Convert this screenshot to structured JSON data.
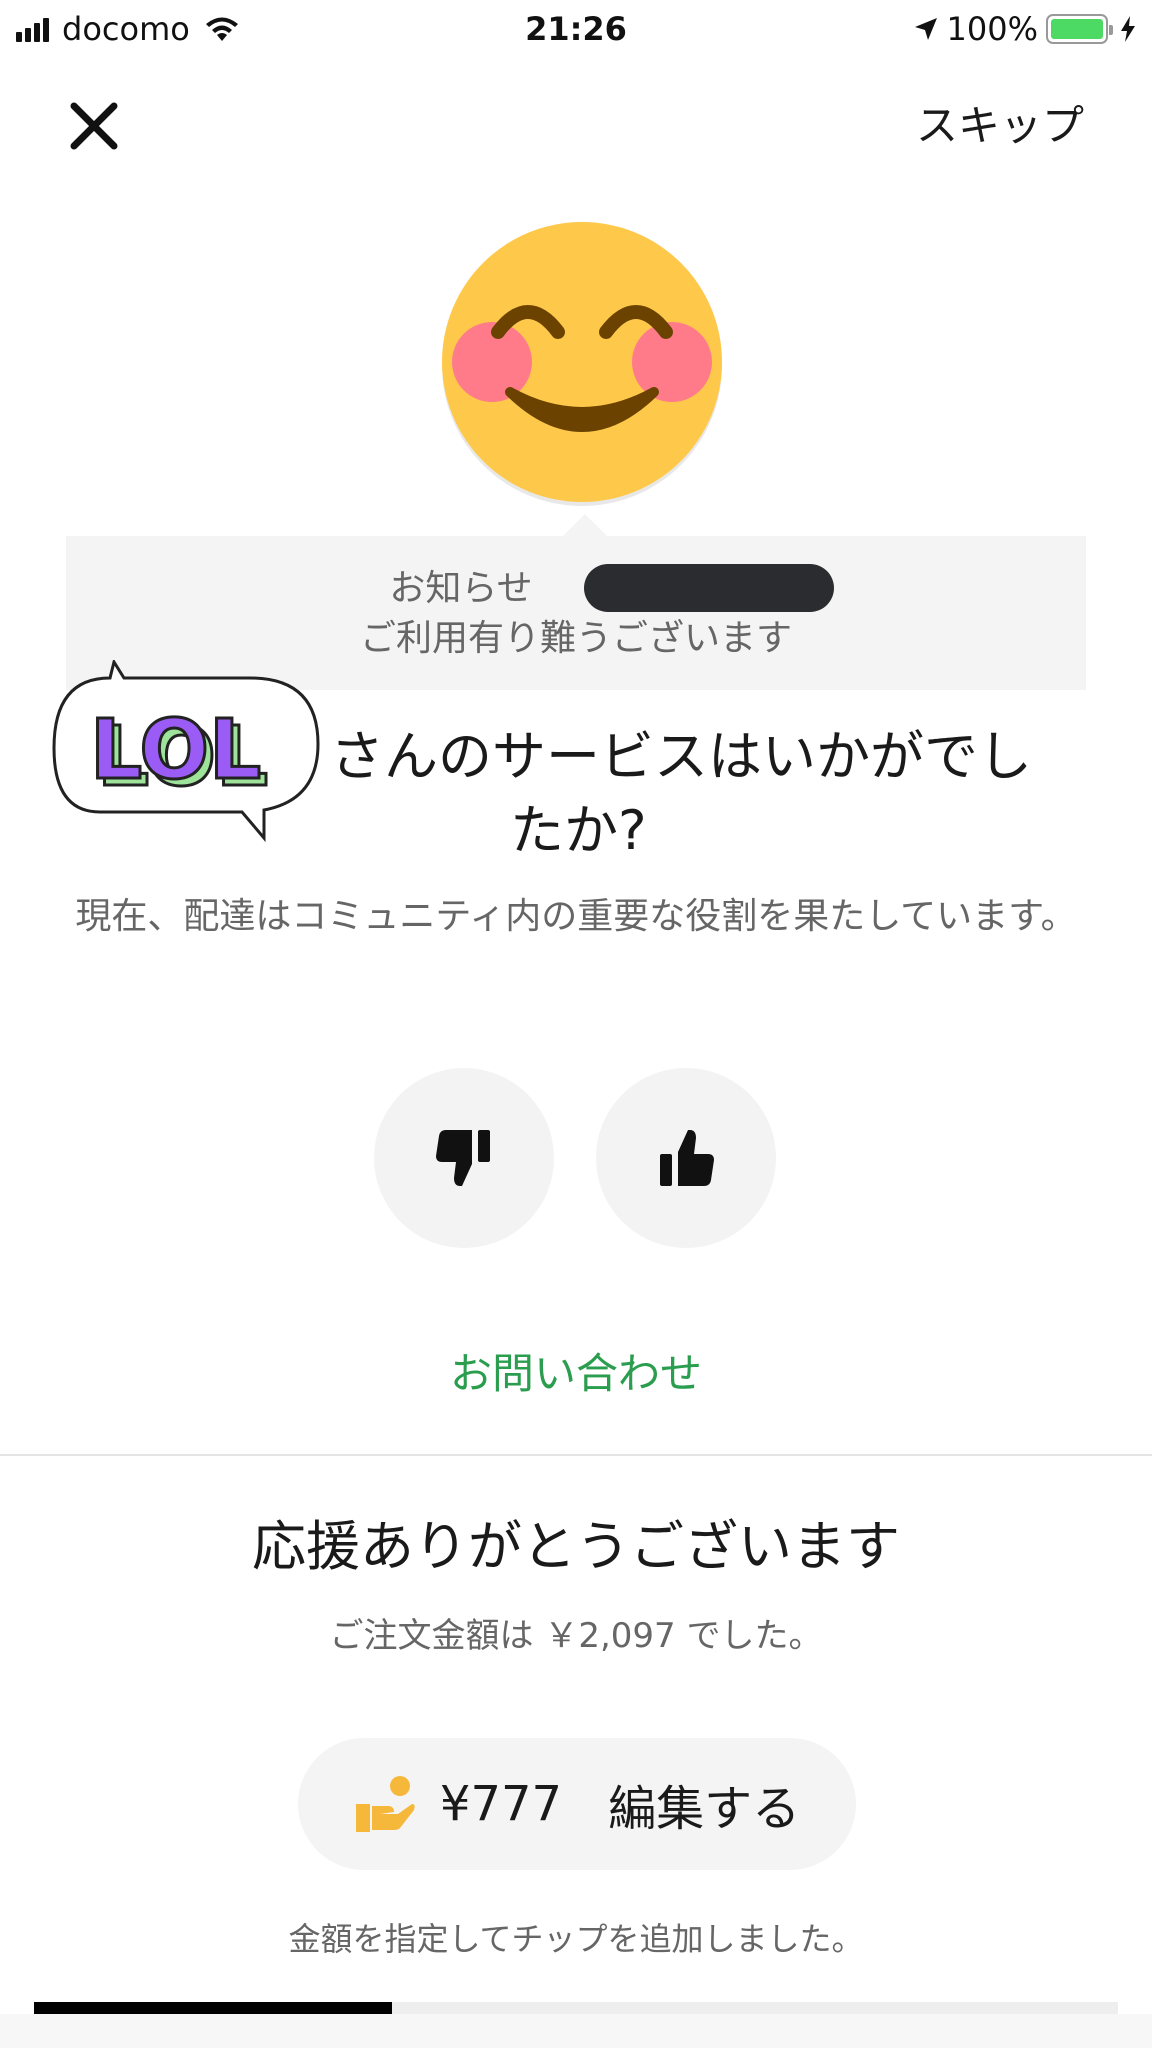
{
  "status_bar": {
    "carrier": "docomo",
    "time": "21:26",
    "battery_percent": "100%",
    "battery_level": 1.0
  },
  "nav": {
    "close_icon": "close-icon",
    "skip_label": "スキップ"
  },
  "emoji": {
    "icon": "smiling-face-blush-icon"
  },
  "notice": {
    "line1": "お知らせ",
    "line2": "ご利用有り難うございます"
  },
  "sticker": {
    "text": "LOL"
  },
  "question": {
    "line1": "さんのサービスはいかがでし",
    "line2": "たか?"
  },
  "subtitle": "現在、配達はコミュニティ内の重要な役割を果たしています。",
  "rating": {
    "thumbs_down_icon": "thumbs-down-icon",
    "thumbs_up_icon": "thumbs-up-icon"
  },
  "contact_label": "お問い合わせ",
  "thanks": {
    "title": "応援ありがとうございます",
    "order_total": "ご注文金額は ￥2,097 でした。"
  },
  "tip": {
    "icon": "hand-giving-icon",
    "amount": "¥777",
    "edit_label": "編集する",
    "note": "金額を指定してチップを追加しました。"
  },
  "progress": {
    "fraction": 0.33
  },
  "colors": {
    "accent_green": "#2a9d4e",
    "emoji_yellow": "#fec94b",
    "tip_icon_orange": "#f6b83a"
  }
}
